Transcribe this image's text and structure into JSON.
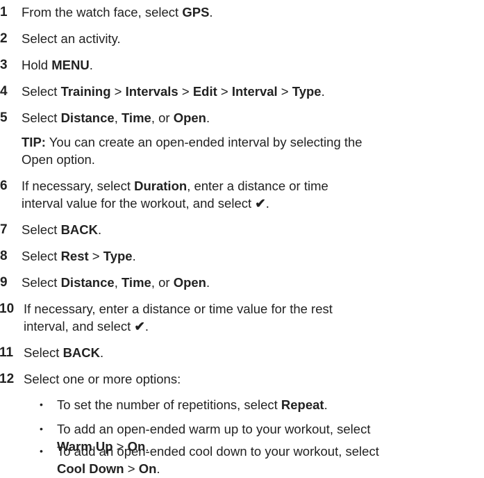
{
  "steps": [
    {
      "num": "1",
      "pre": "From the watch face, select ",
      "b1": "GPS",
      "post": "."
    },
    {
      "num": "2",
      "text": "Select an activity."
    },
    {
      "num": "3",
      "pre": "Hold ",
      "b1": "MENU",
      "post": "."
    },
    {
      "num": "4",
      "pre": "Select ",
      "b1": "Training",
      "s1": " > ",
      "b2": "Intervals",
      "s2": " > ",
      "b3": "Edit",
      "s3": " > ",
      "b4": "Interval",
      "s4": " > ",
      "b5": "Type",
      "post": "."
    },
    {
      "num": "5",
      "pre": "Select ",
      "b1": "Distance",
      "s1": ", ",
      "b2": "Time",
      "s2": ", or ",
      "b3": "Open",
      "post": "."
    },
    {
      "num": "6",
      "pre": "If necessary, select ",
      "b1": "Duration",
      "line1rest": ", enter a distance or time",
      "line2": "interval value for the workout, and select ",
      "check": "✔",
      "post": "."
    },
    {
      "num": "7",
      "pre": "Select ",
      "b1": "BACK",
      "post": "."
    },
    {
      "num": "8",
      "pre": "Select ",
      "b1": "Rest",
      "s1": " > ",
      "b2": "Type",
      "post": "."
    },
    {
      "num": "9",
      "pre": "Select ",
      "b1": "Distance",
      "s1": ", ",
      "b2": "Time",
      "s2": ", or ",
      "b3": "Open",
      "post": "."
    },
    {
      "num": "10",
      "line1": "If necessary, enter a distance or time value for the rest",
      "line2": "interval, and select ",
      "check": "✔",
      "post": "."
    },
    {
      "num": "11",
      "pre": "Select ",
      "b1": "BACK",
      "post": "."
    },
    {
      "num": "12",
      "text": "Select one or more options:"
    }
  ],
  "tip": {
    "label": "TIP:",
    "line1": " You can create an open-ended interval by selecting the",
    "line2": "Open option."
  },
  "bullets": [
    {
      "dot": "•",
      "pre": "To set the number of repetitions, select ",
      "b1": "Repeat",
      "post": "."
    },
    {
      "dot": "•",
      "line1": "To add an open-ended warm up to your workout, select",
      "b1": "Warm Up",
      "s1": " > ",
      "b2": "On",
      "post": "."
    },
    {
      "dot": "•",
      "line1": "To add an open-ended cool down to your workout, select",
      "b1": "Cool Down",
      "s1": " > ",
      "b2": "On",
      "post": "."
    }
  ]
}
